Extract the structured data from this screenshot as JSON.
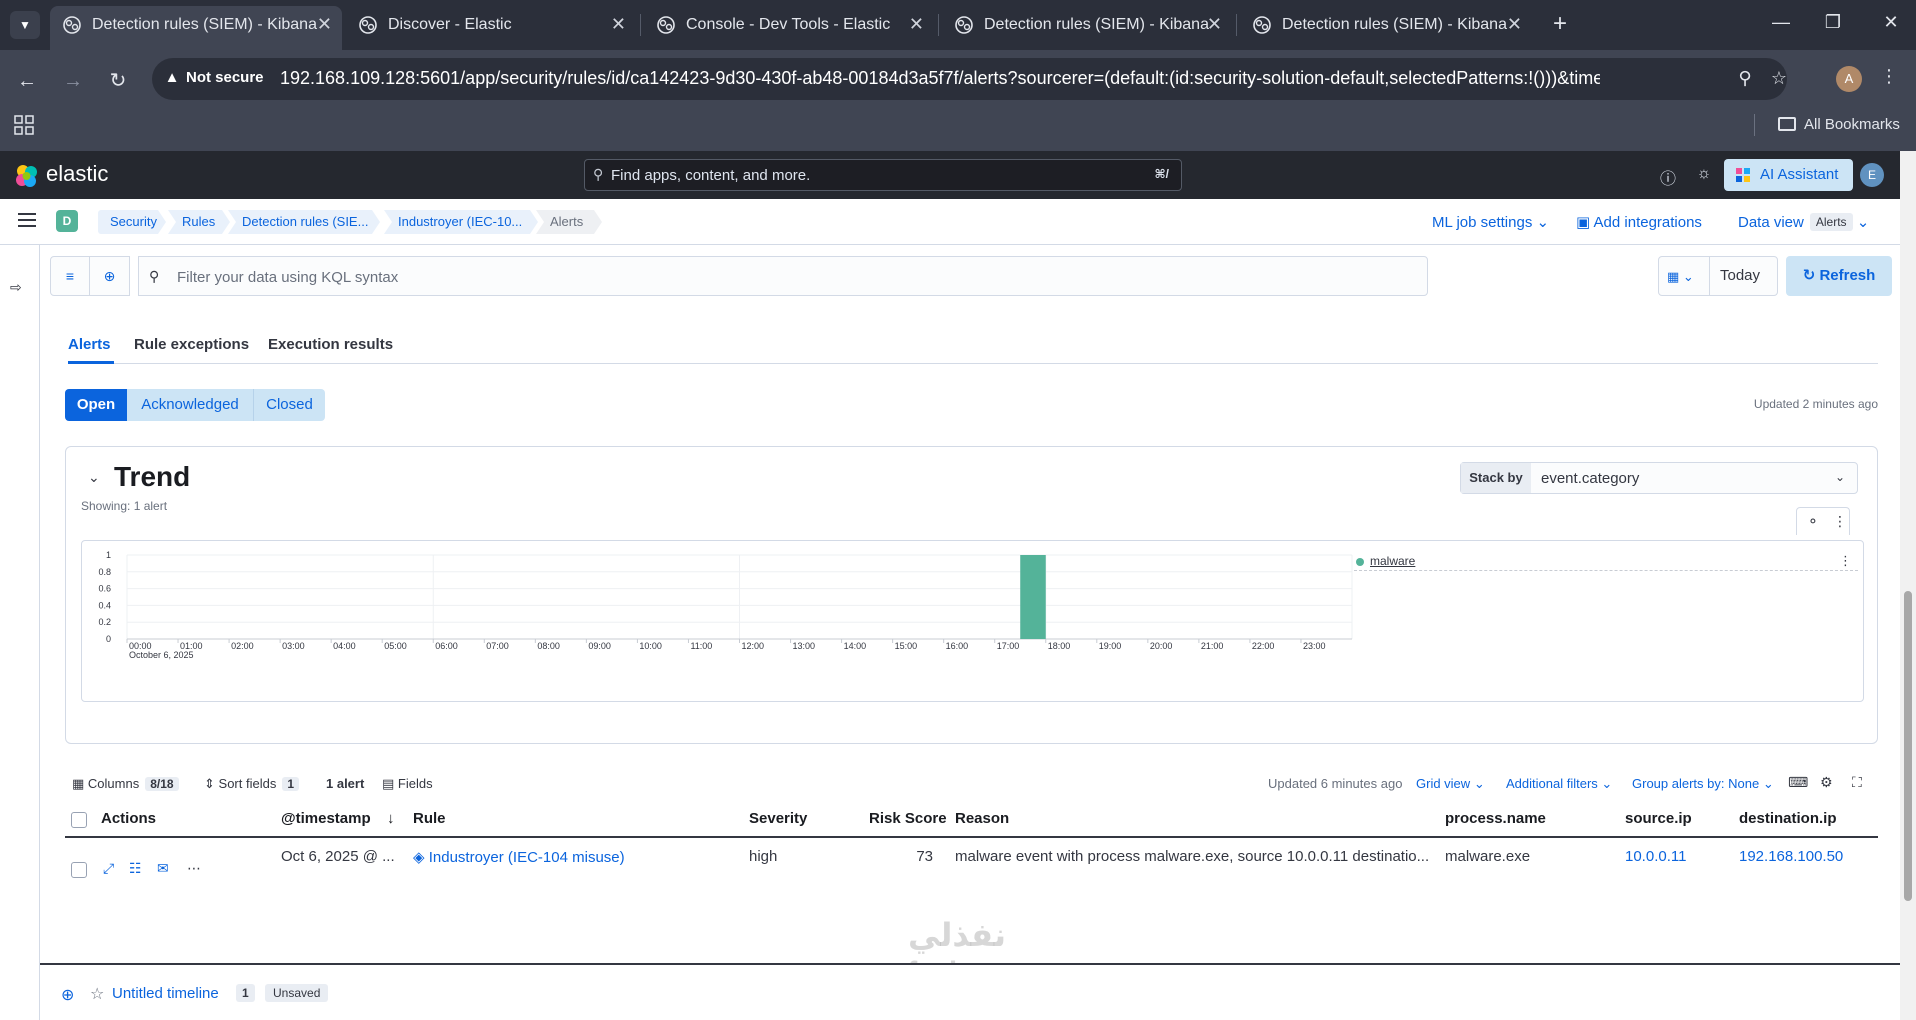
{
  "browser": {
    "tabs": [
      {
        "label": "Detection rules (SIEM) - Kibana",
        "active": true
      },
      {
        "label": "Discover - Elastic",
        "active": false
      },
      {
        "label": "Console - Dev Tools - Elastic",
        "active": false
      },
      {
        "label": "Detection rules (SIEM) - Kibana",
        "active": false
      },
      {
        "label": "Detection rules (SIEM) - Kibana",
        "active": false
      }
    ],
    "security_label": "Not secure",
    "url": "192.168.109.128:5601/app/security/rules/id/ca142423-9d30-430f-ab48-00184d3a5f7f/alerts?sourcerer=(default:(id:security-solution-default,selectedPatterns:!()))&timeline=(activeTab:qu...",
    "profile_initial": "A",
    "bookmarks_label": "All Bookmarks"
  },
  "kibana": {
    "brand": "elastic",
    "search_placeholder": "Find apps, content, and more.",
    "search_shortcut": "⌘/",
    "ai_assistant_label": "AI Assistant",
    "user_initial": "E",
    "space_initial": "D"
  },
  "breadcrumbs": [
    "Security",
    "Rules",
    "Detection rules (SIE...",
    "Industroyer (IEC-10...",
    "Alerts"
  ],
  "header_links": {
    "ml_job_settings": "ML job settings",
    "add_integrations": "Add integrations",
    "data_view_label": "Data view",
    "data_view_value": "Alerts"
  },
  "query": {
    "placeholder": "Filter your data using KQL syntax",
    "date_label": "Today",
    "refresh_label": "Refresh"
  },
  "tabs": [
    "Alerts",
    "Rule exceptions",
    "Execution results"
  ],
  "status_filters": {
    "open": "Open",
    "acknowledged": "Acknowledged",
    "closed": "Closed"
  },
  "updated_top": "Updated 2 minutes ago",
  "trend": {
    "title": "Trend",
    "showing": "Showing: 1 alert",
    "stack_by_label": "Stack by",
    "stack_by_value": "event.category"
  },
  "chart_data": {
    "type": "bar",
    "x_tick_labels": [
      "00:00",
      "01:00",
      "02:00",
      "03:00",
      "04:00",
      "05:00",
      "06:00",
      "07:00",
      "08:00",
      "09:00",
      "10:00",
      "11:00",
      "12:00",
      "13:00",
      "14:00",
      "15:00",
      "16:00",
      "17:00",
      "18:00",
      "19:00",
      "20:00",
      "21:00",
      "22:00",
      "23:00"
    ],
    "x_sublabel": "October 6, 2025",
    "y_ticks": [
      "0",
      "0.2",
      "0.4",
      "0.6",
      "0.8",
      "1"
    ],
    "ylim": [
      0,
      1
    ],
    "series": [
      {
        "name": "malware",
        "color": "#54b399",
        "bars": [
          {
            "x_start_hour": 17.5,
            "x_end_hour": 18.0,
            "value": 1
          }
        ]
      }
    ],
    "legend_position": "right"
  },
  "table_toolbar": {
    "columns_label": "Columns",
    "columns_count": "8/18",
    "sort_label": "Sort fields",
    "sort_count": "1",
    "alert_count": "1 alert",
    "fields_label": "Fields",
    "updated": "Updated 6 minutes ago",
    "grid_view": "Grid view",
    "additional_filters": "Additional filters",
    "group_by": "Group alerts by: None"
  },
  "table": {
    "headers": [
      "Actions",
      "@timestamp",
      "Rule",
      "Severity",
      "Risk Score",
      "Reason",
      "process.name",
      "source.ip",
      "destination.ip"
    ],
    "rows": [
      {
        "timestamp": "Oct 6, 2025 @ ...",
        "rule": "Industroyer (IEC-104 misuse)",
        "severity": "high",
        "risk_score": "73",
        "reason": "malware event with process malware.exe, source 10.0.0.11 destinatio...",
        "process_name": "malware.exe",
        "source_ip": "10.0.0.11",
        "destination_ip": "192.168.100.50"
      }
    ]
  },
  "timeline": {
    "title": "Untitled timeline",
    "count": "1",
    "status": "Unsaved"
  },
  "watermark": {
    "line1": "نفذلي",
    "line2": "nafezly.com"
  }
}
